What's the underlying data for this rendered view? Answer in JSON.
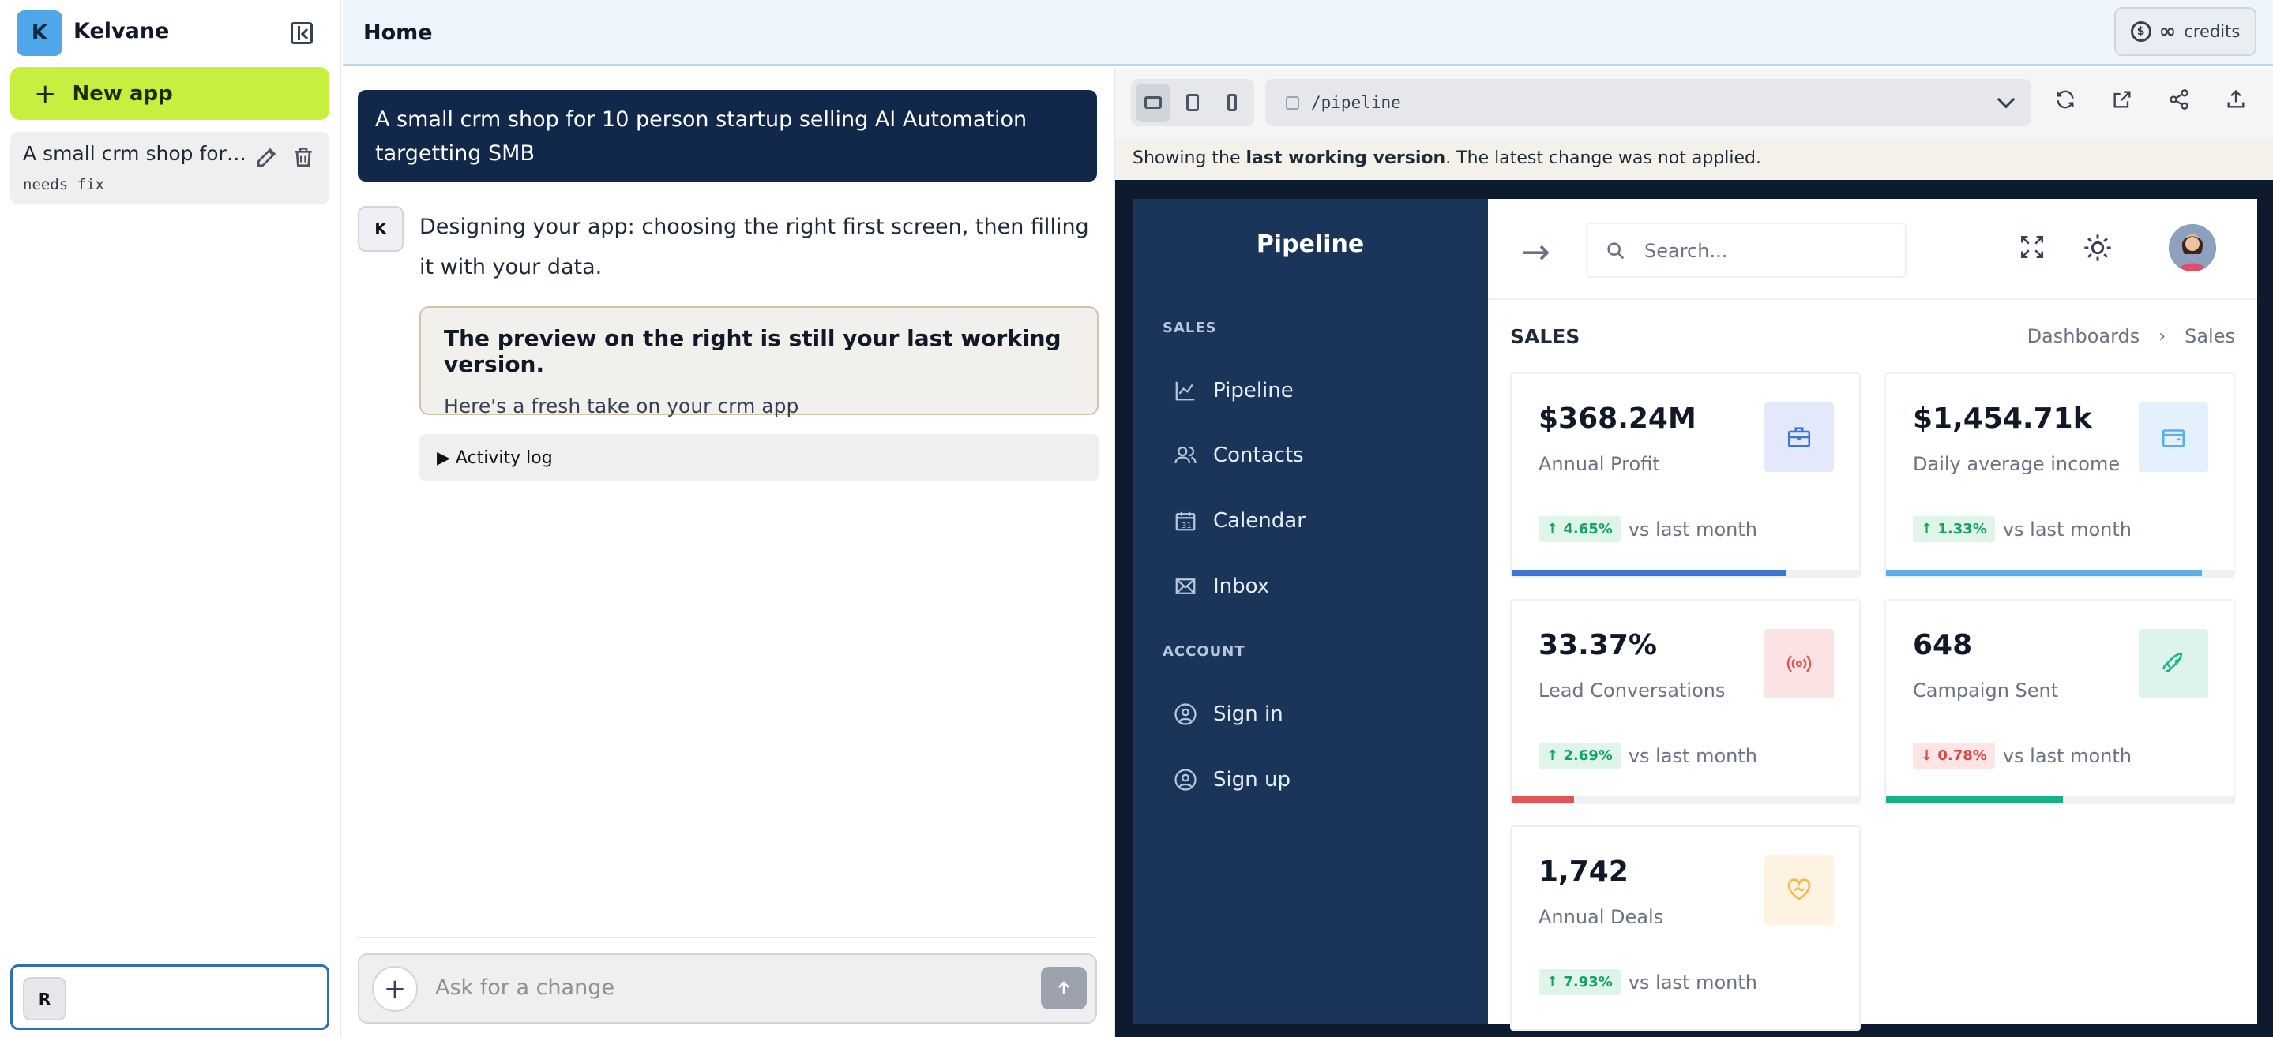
{
  "sidebar": {
    "avatar_letter": "K",
    "workspace_name": "Kelvane",
    "new_app_label": "New app",
    "apps": [
      {
        "title": "A small crm shop for 10 person startup selling AI Automation targetting SMB",
        "status": "needs fix"
      }
    ],
    "user_initial": "R"
  },
  "header": {
    "title": "Home",
    "credits_symbol": "∞",
    "credits_label": "credits"
  },
  "chat": {
    "user_prompt": "A small crm shop for 10 person startup selling AI Automation targetting SMB",
    "assistant_initial": "K",
    "assistant_message": "Designing your app: choosing the right first screen, then filling it with your data.",
    "notice_title": "The preview on the right is still your last working version.",
    "notice_subtitle": "Here's a fresh take on your crm app",
    "activity_label": "▶ Activity log",
    "input_placeholder": "Ask for a change"
  },
  "preview": {
    "url_path": "/pipeline",
    "warning_prefix": "Showing the ",
    "warning_bold": "last working version",
    "warning_suffix": ". The latest change was not applied."
  },
  "app": {
    "sidebar_title": "Pipeline",
    "section_sales": "SALES",
    "nav_sales": [
      {
        "label": "Pipeline",
        "icon": "chart-line-icon"
      },
      {
        "label": "Contacts",
        "icon": "users-icon"
      },
      {
        "label": "Calendar",
        "icon": "calendar-icon"
      },
      {
        "label": "Inbox",
        "icon": "mail-icon"
      }
    ],
    "section_account": "ACCOUNT",
    "nav_account": [
      {
        "label": "Sign in",
        "icon": "user-circle-icon"
      },
      {
        "label": "Sign up",
        "icon": "user-circle-icon"
      }
    ],
    "search_placeholder": "Search...",
    "page_title": "SALES",
    "breadcrumb": [
      "Dashboards",
      "Sales"
    ],
    "comparison_text": "vs last month",
    "cards": [
      {
        "value": "$368.24M",
        "label": "Annual Profit",
        "change": "4.65%",
        "direction": "up",
        "progress": 0.79,
        "color": "#3b76d6",
        "icon_bg": "#e3e9fb",
        "icon": "briefcase-icon"
      },
      {
        "value": "$1,454.71k",
        "label": "Daily average income",
        "change": "1.33%",
        "direction": "up",
        "progress": 0.91,
        "color": "#5aaeea",
        "icon_bg": "#e4f1fc",
        "icon": "wallet-icon"
      },
      {
        "value": "33.37%",
        "label": "Lead Conversations",
        "change": "2.69%",
        "direction": "up",
        "progress": 0.18,
        "color": "#e05656",
        "icon_bg": "#fbe3e3",
        "icon": "broadcast-icon"
      },
      {
        "value": "648",
        "label": "Campaign Sent",
        "change": "0.78%",
        "direction": "down",
        "progress": 0.51,
        "color": "#17b384",
        "icon_bg": "#ddf4ec",
        "icon": "rocket-icon"
      },
      {
        "value": "1,742",
        "label": "Annual Deals",
        "change": "7.93%",
        "direction": "up",
        "progress": 0,
        "color": "#f0b94a",
        "icon_bg": "#fdf3e0",
        "icon": "heart-handshake-icon"
      }
    ]
  }
}
